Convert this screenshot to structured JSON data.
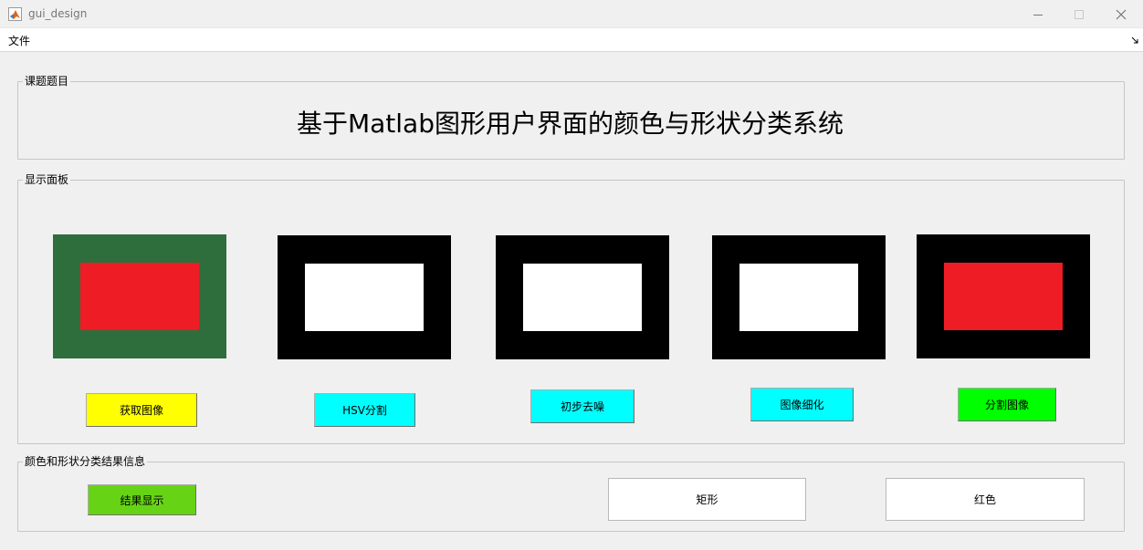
{
  "window": {
    "title": "gui_design"
  },
  "menu": {
    "file": "文件"
  },
  "panels": {
    "topic": {
      "label": "课题题目",
      "title": "基于Matlab图形用户界面的颜色与形状分类系统"
    },
    "display": {
      "label": "显示面板"
    },
    "result": {
      "label": "颜色和形状分类结果信息"
    }
  },
  "images": [
    {
      "outer": "#2e6e3c",
      "inner": "#ee1c25"
    },
    {
      "outer": "#000000",
      "inner": "#ffffff"
    },
    {
      "outer": "#000000",
      "inner": "#ffffff"
    },
    {
      "outer": "#000000",
      "inner": "#ffffff"
    },
    {
      "outer": "#000000",
      "inner": "#ee1c25"
    }
  ],
  "buttons": [
    {
      "label": "获取图像",
      "color": "#ffff00"
    },
    {
      "label": "HSV分割",
      "color": "#00ffff"
    },
    {
      "label": "初步去噪",
      "color": "#00ffff"
    },
    {
      "label": "图像细化",
      "color": "#00ffff"
    },
    {
      "label": "分割图像",
      "color": "#00ff00"
    }
  ],
  "result": {
    "button": {
      "label": "结果显示",
      "color": "#66d414"
    },
    "shape": "矩形",
    "color": "红色"
  }
}
